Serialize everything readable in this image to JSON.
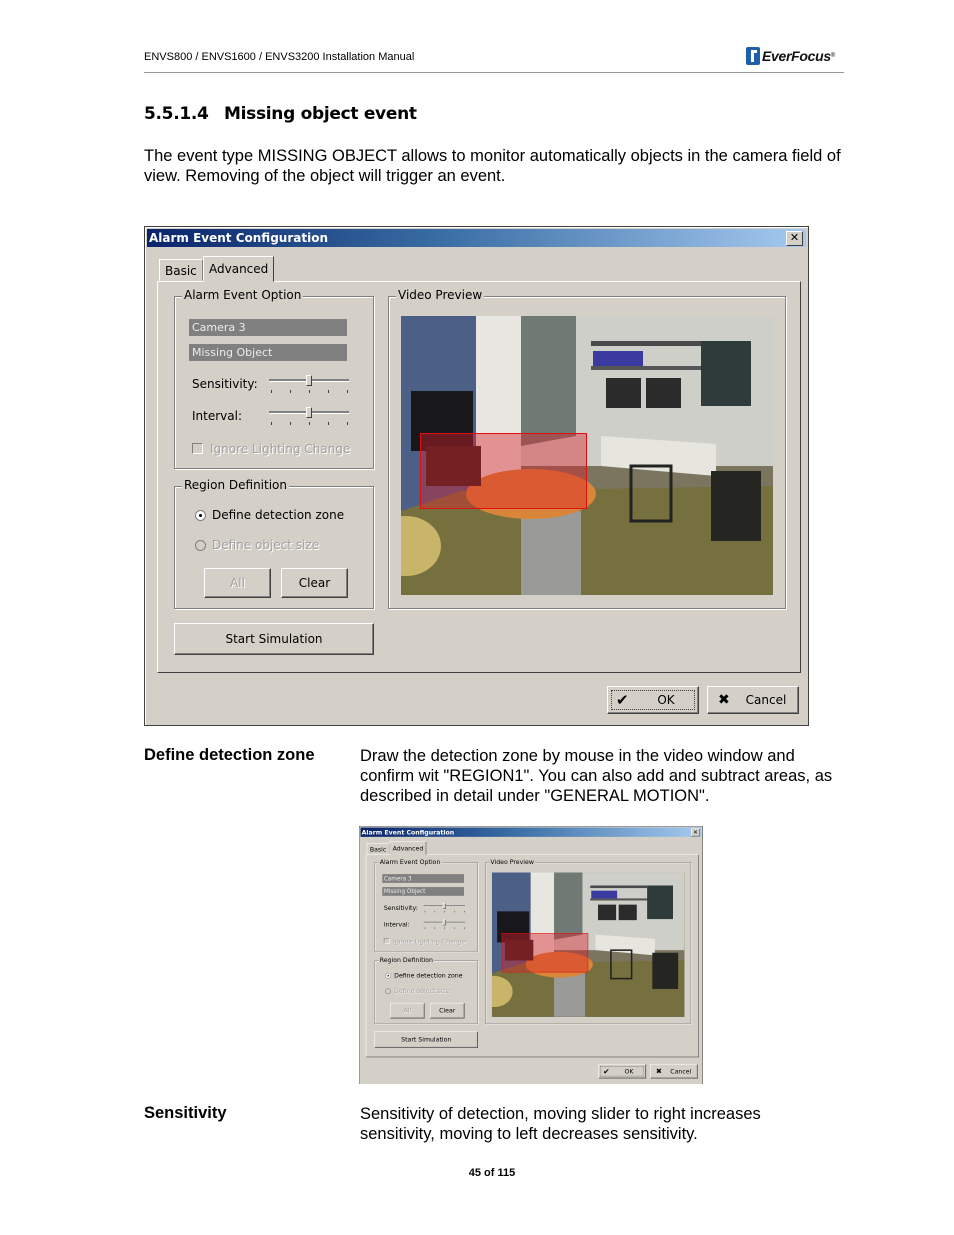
{
  "header": {
    "manual_title": "ENVS800 / ENVS1600 / ENVS3200 Installation Manual",
    "logo_text": "EverFocus",
    "logo_reg": "®",
    "brand_color": "#1f5fa8"
  },
  "section": {
    "number": "5.5.1.4",
    "title": "Missing object event",
    "intro": "The event type MISSING OBJECT allows to monitor automatically objects in the camera field of view. Removing of the object will trigger an event."
  },
  "dialog": {
    "title": "Alarm Event Configuration",
    "close_glyph": "✕",
    "tabs": [
      {
        "label": "Basic",
        "active": false
      },
      {
        "label": "Advanced",
        "active": true
      }
    ],
    "alarm_event_option": {
      "label": "Alarm Event Option",
      "camera": "Camera 3",
      "event_type": "Missing Object",
      "sensitivity_label": "Sensitivity:",
      "sensitivity_value": 0.5,
      "interval_label": "Interval:",
      "interval_value": 0.5,
      "ignore_lighting_label": "Ignore Lighting Change",
      "ignore_lighting_checked": false
    },
    "region_definition": {
      "label": "Region Definition",
      "options": [
        {
          "label": "Define detection zone",
          "selected": true,
          "enabled": true
        },
        {
          "label": "Define object size",
          "selected": false,
          "enabled": false
        }
      ],
      "all_label": "All",
      "clear_label": "Clear"
    },
    "start_simulation_label": "Start Simulation",
    "video_preview_label": "Video Preview",
    "ok_label": "OK",
    "cancel_label": "Cancel",
    "ok_icon": "✔",
    "cancel_icon": "✖",
    "zone_color": "#e01010"
  },
  "definitions": [
    {
      "term": "Define detection zone",
      "description": "Draw the detection zone by mouse in the video window and confirm wit \"REGION1\". You can also add and subtract areas, as described in detail under \"GENERAL MOTION\"."
    },
    {
      "term": "Sensitivity",
      "description": "Sensitivity of detection, moving slider to right increases sensitivity, moving to left decreases sensitivity."
    }
  ],
  "footer": {
    "page": "45 of 115"
  }
}
